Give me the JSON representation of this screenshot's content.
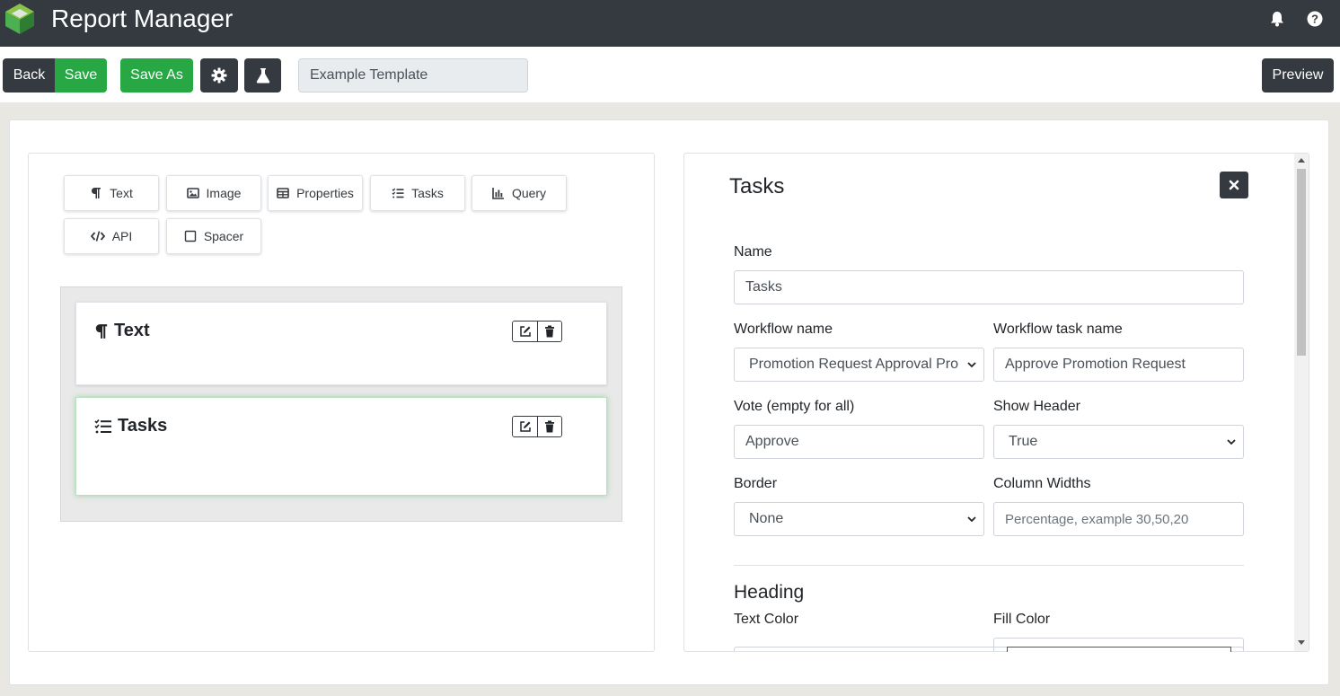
{
  "app": {
    "title": "Report Manager",
    "icons": [
      "bell-icon",
      "help-icon"
    ]
  },
  "toolbar": {
    "back_label": "Back",
    "save_label": "Save",
    "save_as_label": "Save As",
    "settings_icon": "gear-icon",
    "test_icon": "flask-icon",
    "template_name": "Example Template",
    "preview_label": "Preview"
  },
  "palette": {
    "items": [
      {
        "label": "Text",
        "icon": "paragraph-icon"
      },
      {
        "label": "Image",
        "icon": "image-icon"
      },
      {
        "label": "Properties",
        "icon": "table-icon"
      },
      {
        "label": "Tasks",
        "icon": "tasks-icon"
      },
      {
        "label": "Query",
        "icon": "chart-icon"
      },
      {
        "label": "API",
        "icon": "code-icon"
      },
      {
        "label": "Spacer",
        "icon": "square-icon"
      }
    ]
  },
  "canvas": {
    "blocks": [
      {
        "title": "Text",
        "icon": "paragraph-icon"
      },
      {
        "title": "Tasks",
        "icon": "tasks-icon"
      }
    ]
  },
  "editor": {
    "title": "Tasks",
    "fields": {
      "name_label": "Name",
      "name_value": "Tasks",
      "workflow_name_label": "Workflow name",
      "workflow_name_value": "Promotion Request Approval Pro",
      "workflow_task_label": "Workflow task name",
      "workflow_task_value": "Approve Promotion Request",
      "vote_label": "Vote (empty for all)",
      "vote_value": "Approve",
      "show_header_label": "Show Header",
      "show_header_value": "True",
      "border_label": "Border",
      "border_value": "None",
      "column_widths_label": "Column Widths",
      "column_widths_placeholder": "Percentage, example 30,50,20"
    },
    "heading_section": "Heading",
    "text_color_label": "Text Color",
    "fill_color_label": "Fill Color"
  },
  "colors": {
    "topbar": "#343a40",
    "success": "#28a745",
    "dark": "#343a40"
  }
}
